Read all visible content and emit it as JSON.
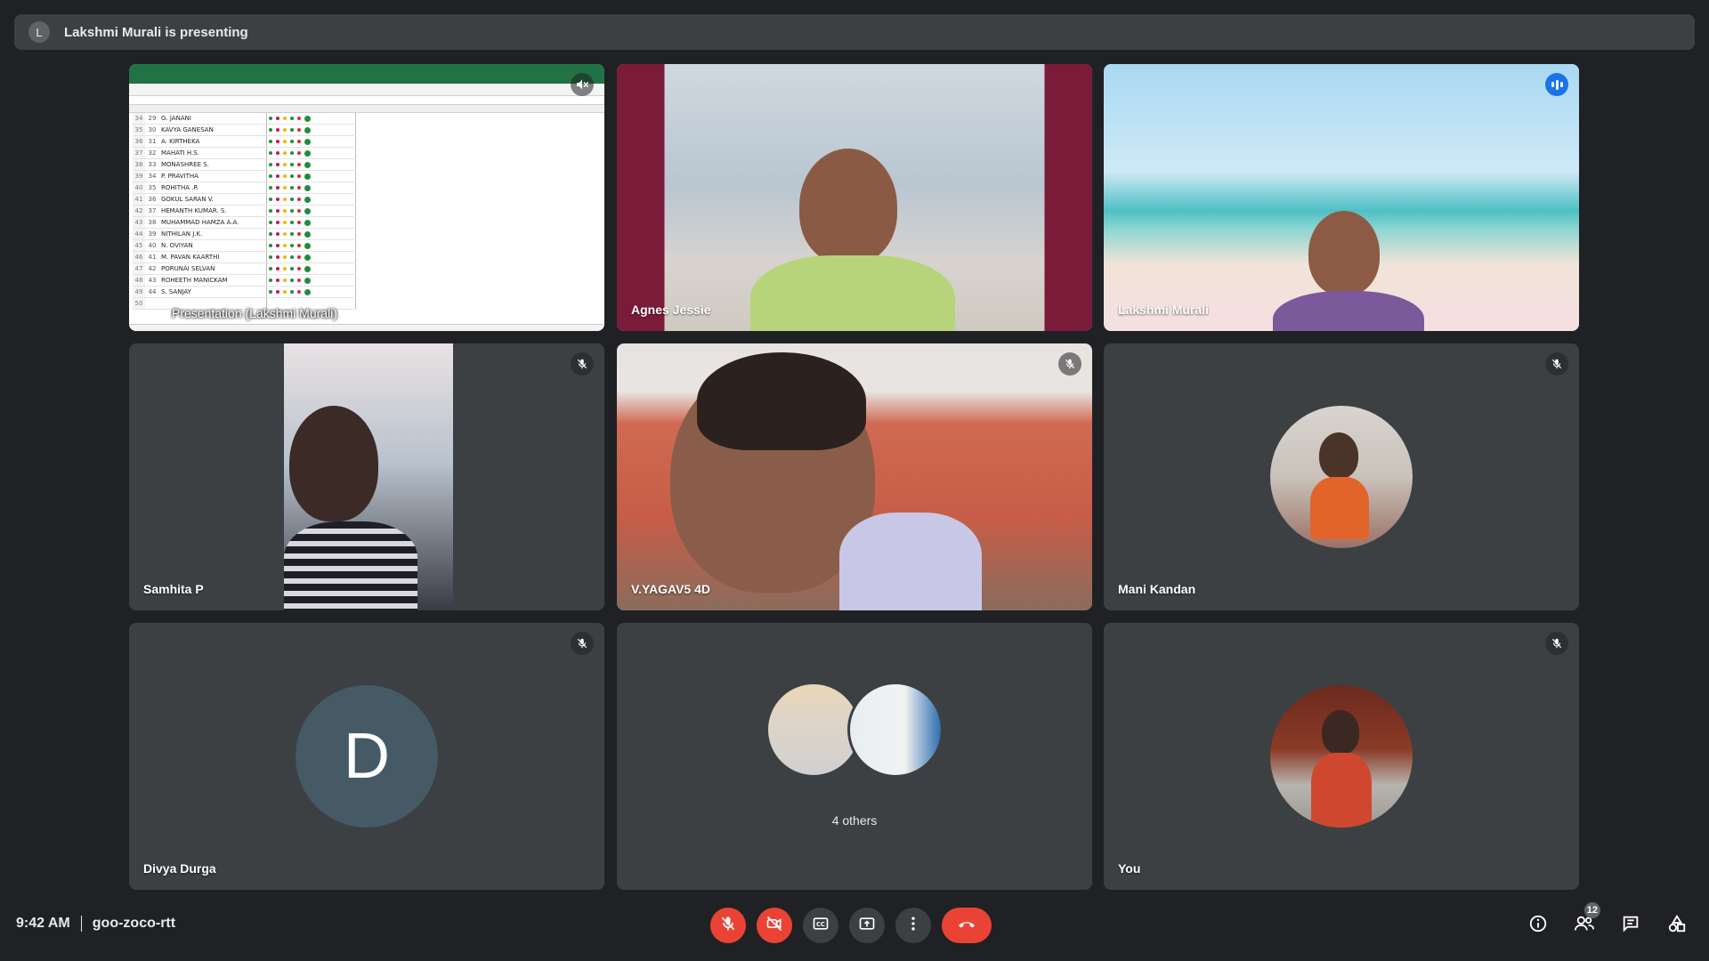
{
  "banner": {
    "avatar_letter": "L",
    "text": "Lakshmi Murali is presenting"
  },
  "presentation": {
    "label": "Presentation (Lakshmi Murali)",
    "rows": [
      {
        "row": "34",
        "sn": "29",
        "name": "G. JANANI"
      },
      {
        "row": "35",
        "sn": "30",
        "name": "KAVYA GANESAN"
      },
      {
        "row": "36",
        "sn": "31",
        "name": "A. KIRTHEKA"
      },
      {
        "row": "37",
        "sn": "32",
        "name": "MAHATI H.S."
      },
      {
        "row": "38",
        "sn": "33",
        "name": "MONASHREE S."
      },
      {
        "row": "39",
        "sn": "34",
        "name": "P. PRAVITHA"
      },
      {
        "row": "40",
        "sn": "35",
        "name": "ROHITHA .R"
      },
      {
        "row": "41",
        "sn": "36",
        "name": "GOKUL SARAN V."
      },
      {
        "row": "42",
        "sn": "37",
        "name": "HEMANTH KUMAR. S."
      },
      {
        "row": "43",
        "sn": "38",
        "name": "MUHAMMAD HAMZA A.A."
      },
      {
        "row": "44",
        "sn": "39",
        "name": "NITHILAN J.K."
      },
      {
        "row": "45",
        "sn": "40",
        "name": "N. OVIYAN"
      },
      {
        "row": "46",
        "sn": "41",
        "name": "M. PAVAN KAARTHI"
      },
      {
        "row": "47",
        "sn": "42",
        "name": "PORUNAI SELVAN"
      },
      {
        "row": "48",
        "sn": "43",
        "name": "ROHEETH MANICKAM"
      },
      {
        "row": "49",
        "sn": "44",
        "name": "S. SANJAY"
      },
      {
        "row": "50",
        "sn": "",
        "name": ""
      }
    ]
  },
  "participants": {
    "agnes": "Agnes Jessie",
    "lakshmi": "Lakshmi Murali",
    "samhita": "Samhita P",
    "yagav": "V.YAGAV5 4D",
    "mani": "Mani Kandan",
    "divya": "Divya Durga",
    "divya_letter": "D",
    "others": "4 others",
    "you": "You"
  },
  "bottom": {
    "time": "9:42 AM",
    "meeting_code": "goo-zoco-rtt",
    "people_count": "12"
  },
  "icons": {
    "mic_off": "mic-off-icon",
    "camera_off": "videocam-off-icon",
    "captions": "closed-captions-icon",
    "present": "present-screen-icon",
    "more": "more-vert-icon",
    "hangup": "call-end-icon",
    "info": "info-icon",
    "people": "people-icon",
    "chat": "chat-icon",
    "activities": "activities-icon"
  },
  "colors": {
    "background": "#202124",
    "tile": "#3c4043",
    "danger": "#ea4335",
    "speaking": "#1a73e8"
  }
}
